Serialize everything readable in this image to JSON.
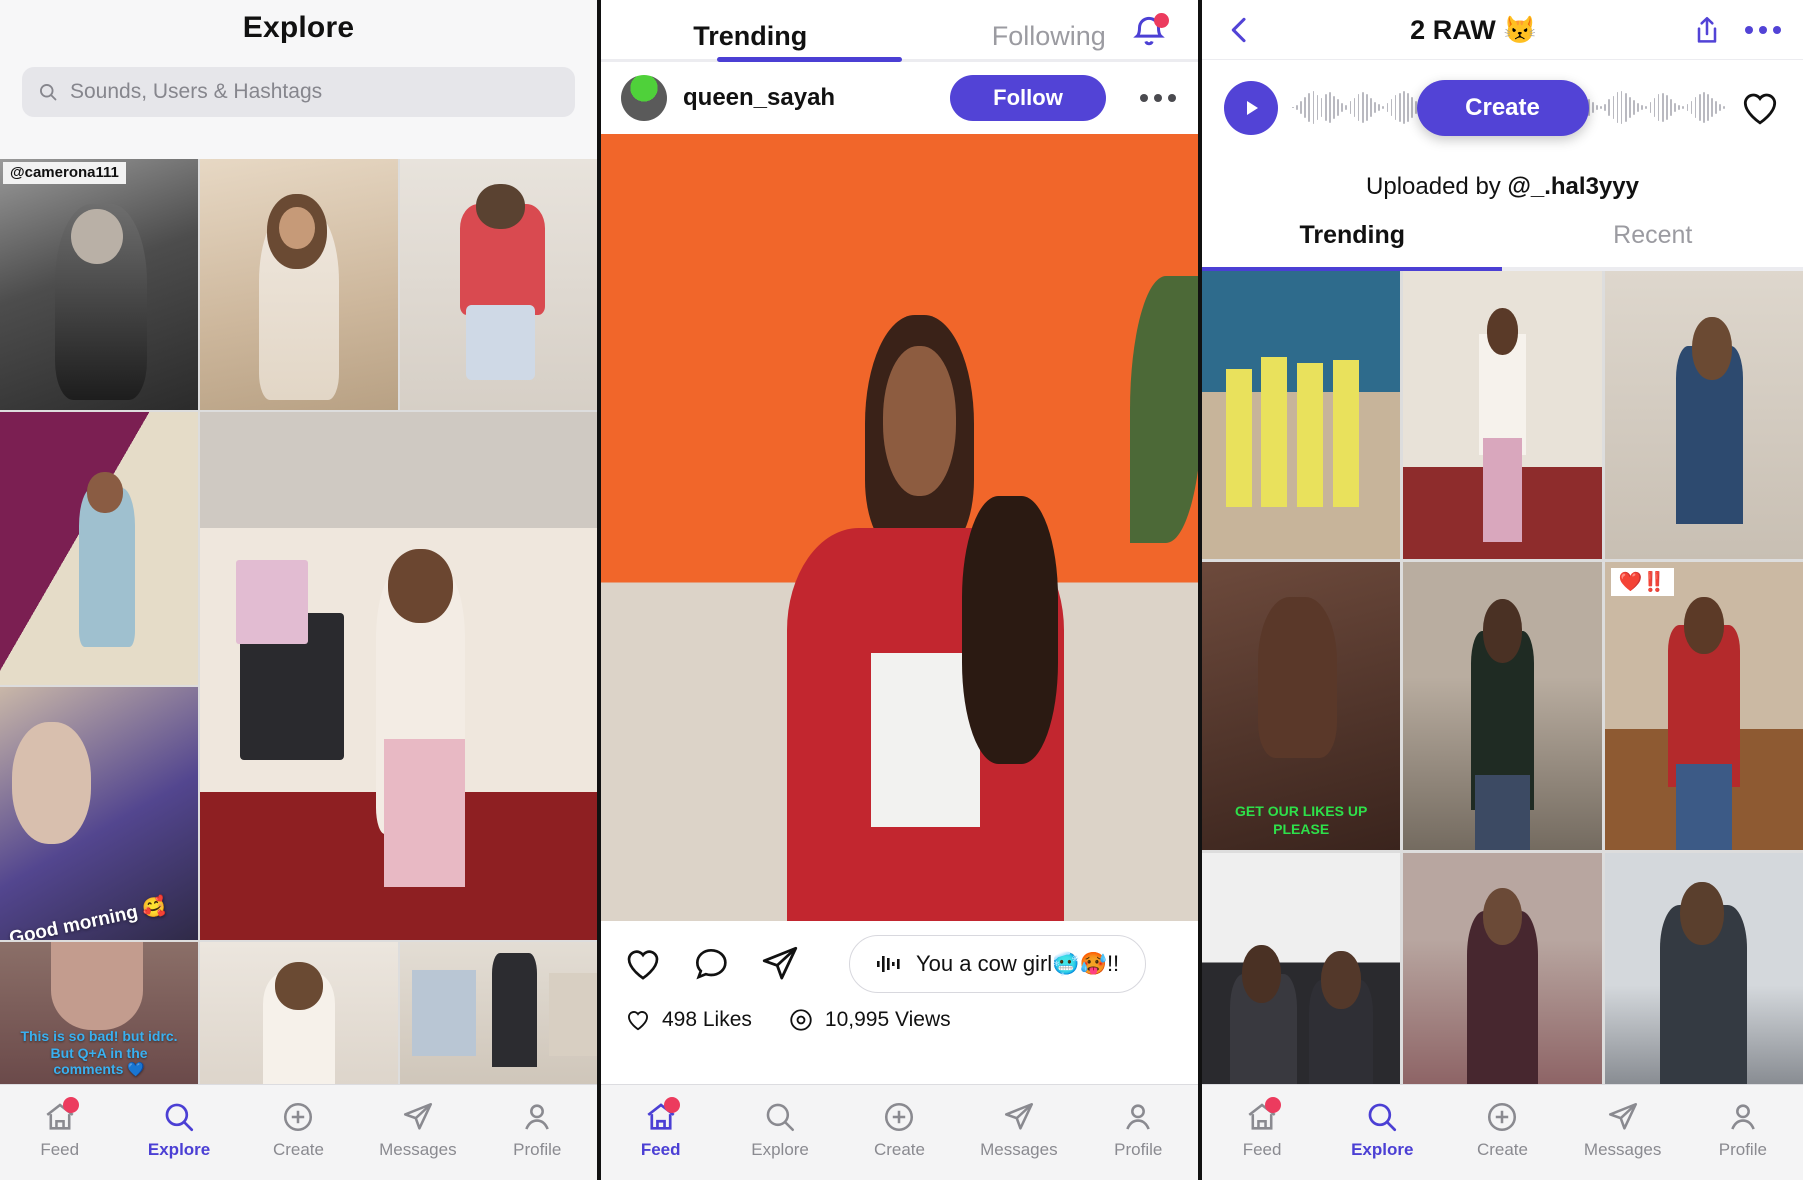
{
  "accent": "#5243d6",
  "badge_red": "#ec3b5e",
  "explore": {
    "title": "Explore",
    "search": {
      "placeholder": "Sounds, Users & Hashtags",
      "value": "",
      "icon": "search-icon"
    },
    "tiles": [
      {
        "caption": "@camerona111",
        "style": "username-tag"
      },
      {
        "caption": "",
        "style": "none"
      },
      {
        "caption": "",
        "style": "none"
      },
      {
        "caption": "",
        "style": "none"
      },
      {
        "caption": "",
        "style": "none"
      },
      {
        "caption": "Good morning 🥰",
        "style": "handwriting-white"
      },
      {
        "caption": "This is so bad! but idrc.\nBut Q+A in the\ncomments 💙",
        "style": "blue-bold"
      },
      {
        "caption": "",
        "style": "none"
      },
      {
        "caption": "",
        "style": "none"
      }
    ],
    "nav": {
      "items": [
        {
          "label": "Feed",
          "icon": "home-icon",
          "active": false,
          "badge": true
        },
        {
          "label": "Explore",
          "icon": "search-icon",
          "active": true,
          "badge": false
        },
        {
          "label": "Create",
          "icon": "plus-circle-icon",
          "active": false,
          "badge": false
        },
        {
          "label": "Messages",
          "icon": "paper-plane-icon",
          "active": false,
          "badge": false
        },
        {
          "label": "Profile",
          "icon": "person-icon",
          "active": false,
          "badge": false
        }
      ]
    }
  },
  "feed": {
    "tabs": [
      {
        "label": "Trending",
        "selected": true
      },
      {
        "label": "Following",
        "selected": false
      }
    ],
    "bell": {
      "icon": "bell-icon",
      "has_badge": true
    },
    "post": {
      "username": "queen_sayah",
      "follow_label": "Follow",
      "more_icon": "more-horizontal-icon",
      "actions": [
        {
          "icon": "heart-icon"
        },
        {
          "icon": "comment-icon"
        },
        {
          "icon": "share-icon"
        }
      ],
      "sound_pill": {
        "icon": "sound-wave-icon",
        "text": "You a cow girl🥶🥵!!"
      },
      "likes": "498 Likes",
      "views": "10,995 Views",
      "likes_icon": "heart-icon",
      "views_icon": "eye-icon"
    },
    "nav": {
      "items": [
        {
          "label": "Feed",
          "icon": "home-icon",
          "active": true,
          "badge": true
        },
        {
          "label": "Explore",
          "icon": "search-icon",
          "active": false,
          "badge": false
        },
        {
          "label": "Create",
          "icon": "plus-circle-icon",
          "active": false,
          "badge": false
        },
        {
          "label": "Messages",
          "icon": "paper-plane-icon",
          "active": false,
          "badge": false
        },
        {
          "label": "Profile",
          "icon": "person-icon",
          "active": false,
          "badge": false
        }
      ]
    }
  },
  "sound": {
    "back_icon": "chevron-left-icon",
    "title": "2 RAW 😾",
    "share_icon": "share-up-icon",
    "more_icon": "more-horizontal-icon",
    "play_icon": "play-icon",
    "create_label": "Create",
    "favorite_icon": "heart-icon",
    "uploaded_prefix": "Uploaded by ",
    "uploaded_user": "@_.hal3yyy",
    "tabs": [
      {
        "label": "Trending",
        "selected": true
      },
      {
        "label": "Recent",
        "selected": false
      }
    ],
    "tiles": [
      {
        "caption": "",
        "style": "none"
      },
      {
        "caption": "",
        "style": "none"
      },
      {
        "caption": "",
        "style": "none"
      },
      {
        "caption": "GET OUR LIKES UP\nPLEASE",
        "style": "green-bold"
      },
      {
        "caption": "",
        "style": "none"
      },
      {
        "caption": "❤️‼️",
        "style": "white-badge"
      },
      {
        "caption": "",
        "style": "none"
      },
      {
        "caption": "",
        "style": "none"
      },
      {
        "caption": "",
        "style": "none"
      }
    ],
    "nav": {
      "items": [
        {
          "label": "Feed",
          "icon": "home-icon",
          "active": false,
          "badge": true
        },
        {
          "label": "Explore",
          "icon": "search-icon",
          "active": true,
          "badge": false
        },
        {
          "label": "Create",
          "icon": "plus-circle-icon",
          "active": false,
          "badge": false
        },
        {
          "label": "Messages",
          "icon": "paper-plane-icon",
          "active": false,
          "badge": false
        },
        {
          "label": "Profile",
          "icon": "person-icon",
          "active": false,
          "badge": false
        }
      ]
    }
  }
}
